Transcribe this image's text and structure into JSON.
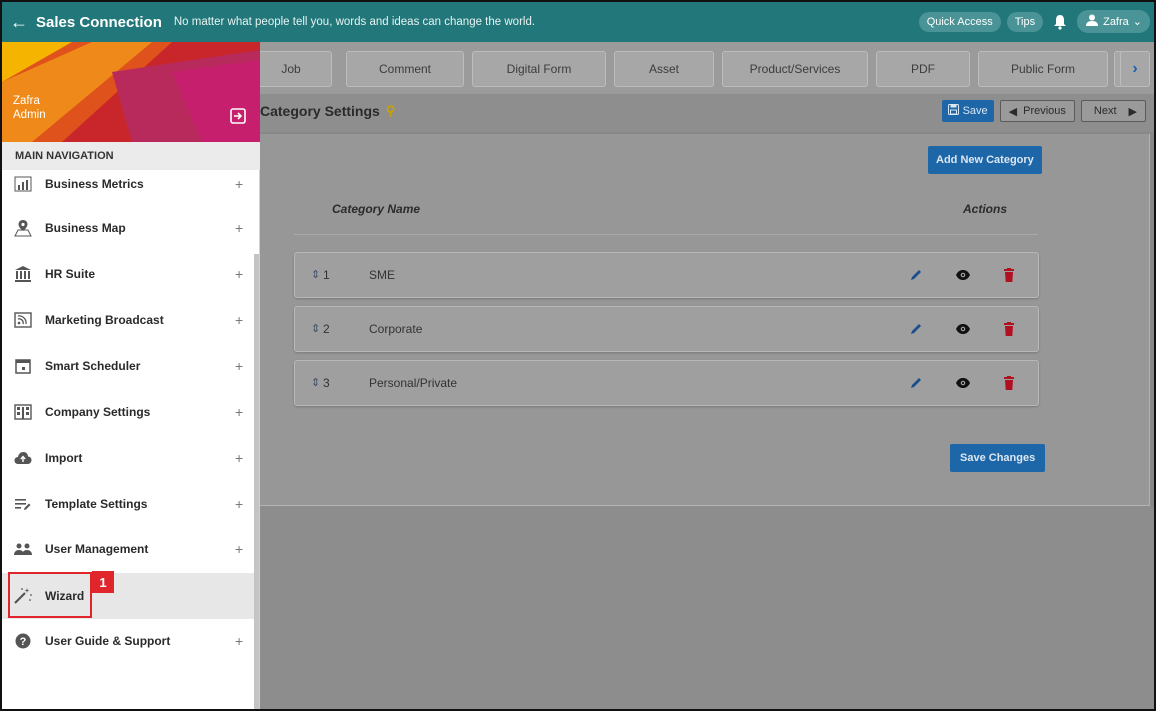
{
  "topbar": {
    "brand": "Sales Connection",
    "tagline": "No matter what people tell you, words and ideas can change the world.",
    "quick_access": "Quick Access",
    "tips": "Tips",
    "user": "Zafra"
  },
  "tabs": [
    {
      "label": "Job"
    },
    {
      "label": "Comment"
    },
    {
      "label": "Digital Form"
    },
    {
      "label": "Asset"
    },
    {
      "label": "Product/Services"
    },
    {
      "label": "PDF"
    },
    {
      "label": "Public Form"
    }
  ],
  "page": {
    "title": "Category Settings",
    "save": "Save",
    "previous": "Previous",
    "next": "Next"
  },
  "categories": {
    "add_button": "Add New Category",
    "col_name": "Category Name",
    "col_actions": "Actions",
    "rows": [
      {
        "num": "1",
        "name": "SME"
      },
      {
        "num": "2",
        "name": "Corporate"
      },
      {
        "num": "3",
        "name": "Personal/Private"
      }
    ],
    "save_changes": "Save Changes"
  },
  "sidebar": {
    "user_name": "Zafra",
    "user_role": "Admin",
    "nav_header": "MAIN NAVIGATION",
    "items": [
      {
        "label": "Business Metrics",
        "icon": "chart-icon",
        "expandable": true
      },
      {
        "label": "Business Map",
        "icon": "map-pin-icon",
        "expandable": true
      },
      {
        "label": "HR Suite",
        "icon": "bank-icon",
        "expandable": true
      },
      {
        "label": "Marketing Broadcast",
        "icon": "broadcast-icon",
        "expandable": true
      },
      {
        "label": "Smart Scheduler",
        "icon": "calendar-icon",
        "expandable": true
      },
      {
        "label": "Company Settings",
        "icon": "building-icon",
        "expandable": true
      },
      {
        "label": "Import",
        "icon": "cloud-upload-icon",
        "expandable": true
      },
      {
        "label": "Template Settings",
        "icon": "template-icon",
        "expandable": true
      },
      {
        "label": "User Management",
        "icon": "users-icon",
        "expandable": true
      },
      {
        "label": "Wizard",
        "icon": "magic-wand-icon",
        "expandable": false
      },
      {
        "label": "User Guide & Support",
        "icon": "help-icon",
        "expandable": true
      }
    ]
  },
  "annotation": {
    "badge": "1"
  },
  "colors": {
    "topbar": "#21777a",
    "primary_button": "#1d66a8",
    "delete": "#b01020",
    "annotation": "#e0262c"
  }
}
